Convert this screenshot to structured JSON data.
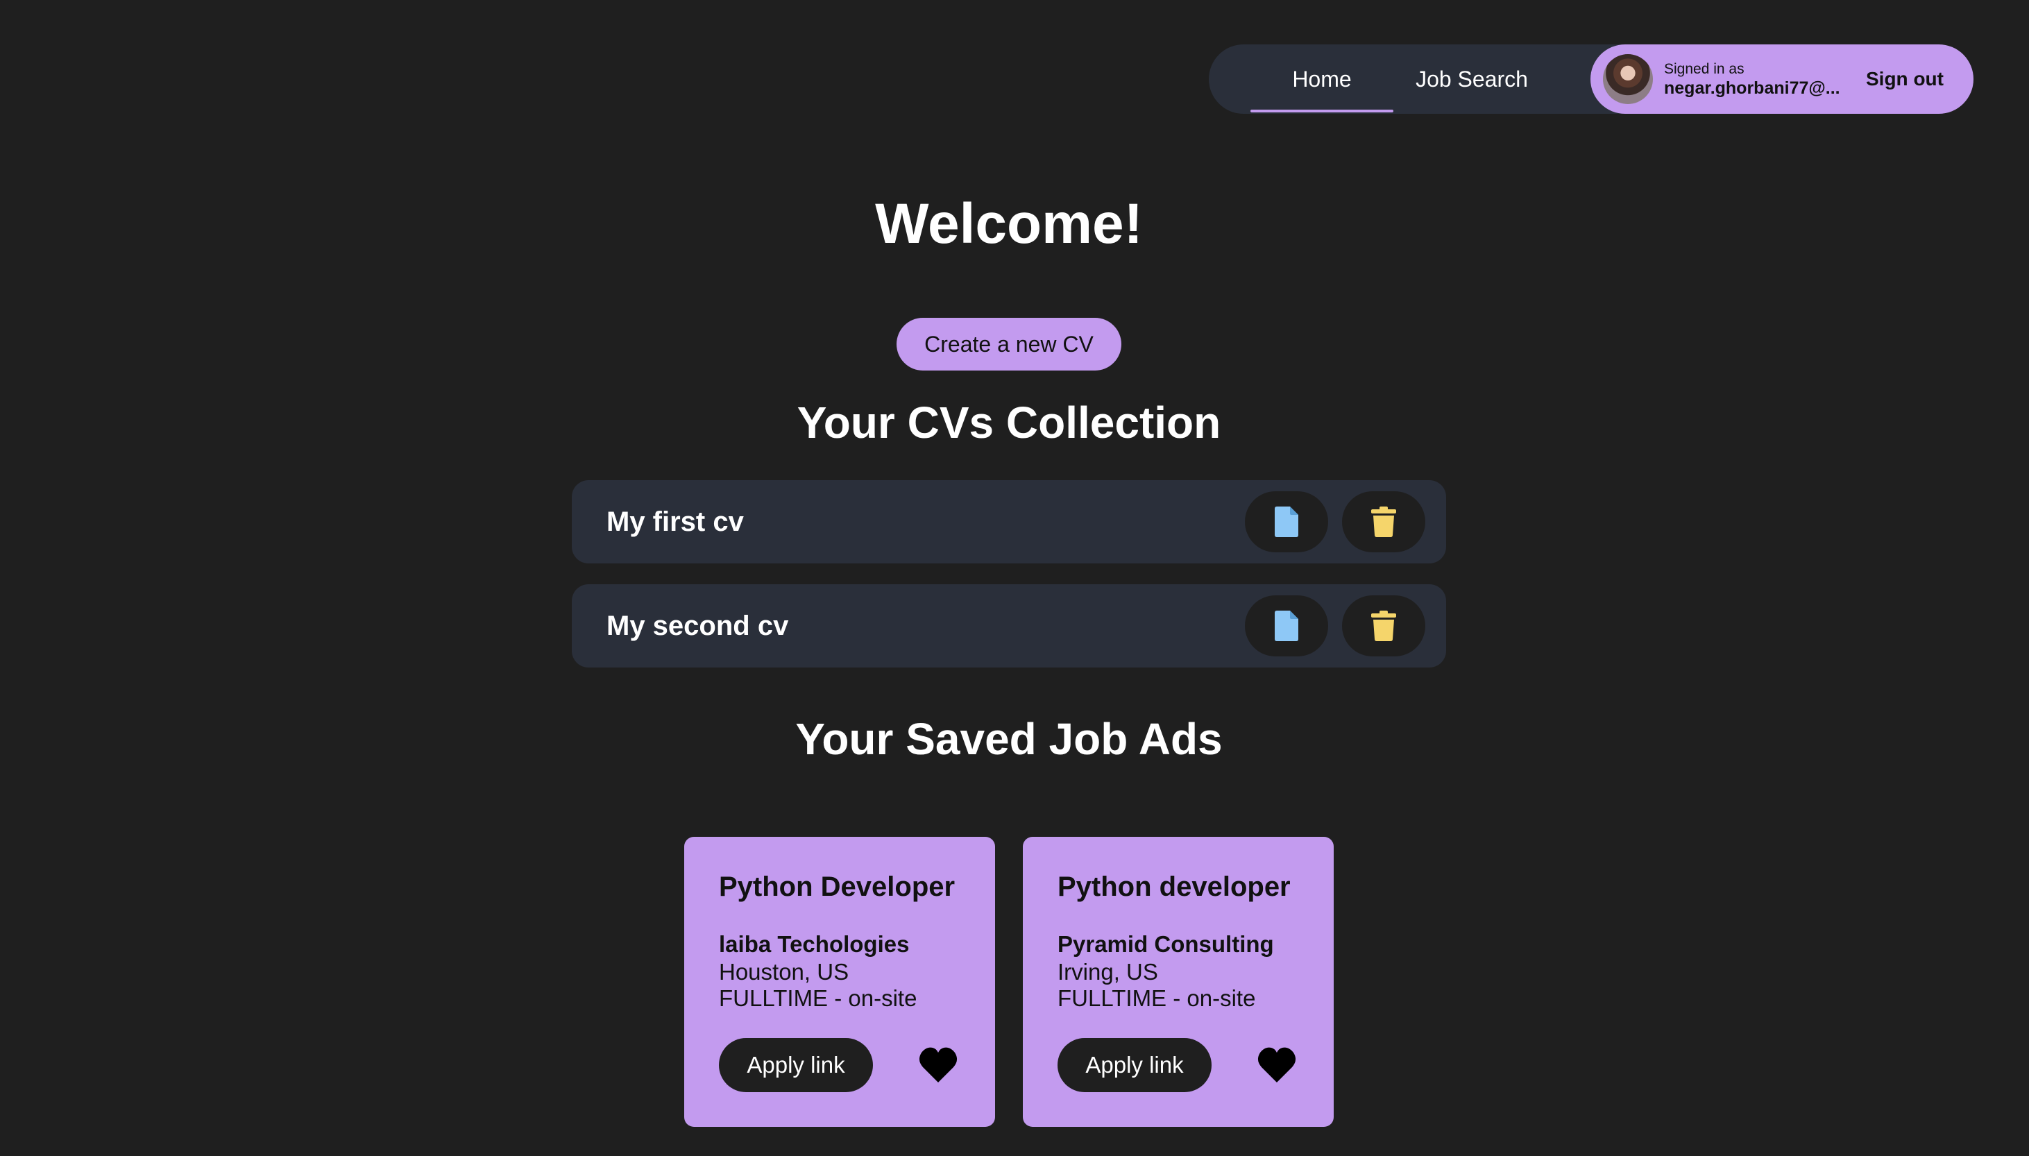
{
  "nav": {
    "tabs": [
      {
        "label": "Home",
        "active": true
      },
      {
        "label": "Job Search",
        "active": false
      }
    ],
    "user": {
      "signed_in_label": "Signed in as",
      "email": "negar.ghorbani77@...",
      "sign_out_label": "Sign out"
    }
  },
  "main": {
    "welcome": "Welcome!",
    "create_cv_label": "Create a new CV",
    "cv_section_title": "Your CVs Collection",
    "cvs": [
      {
        "name": "My first cv",
        "open_icon": "file-icon",
        "delete_icon": "trash-icon"
      },
      {
        "name": "My second cv",
        "open_icon": "file-icon",
        "delete_icon": "trash-icon"
      }
    ],
    "jobs_section_title": "Your Saved Job Ads",
    "jobs": [
      {
        "title": "Python Developer",
        "company": "laiba Techologies",
        "location": "Houston, US",
        "type": "FULLTIME - on-site",
        "apply_label": "Apply link",
        "saved_icon": "heart-icon"
      },
      {
        "title": "Python developer",
        "company": "Pyramid Consulting",
        "location": "Irving, US",
        "type": "FULLTIME - on-site",
        "apply_label": "Apply link",
        "saved_icon": "heart-icon"
      }
    ]
  },
  "colors": {
    "background": "#1f1f1f",
    "panel": "#2a2f3a",
    "accent": "#c39bef",
    "file_icon": "#8ec8f6",
    "trash_icon": "#f5d56b"
  }
}
